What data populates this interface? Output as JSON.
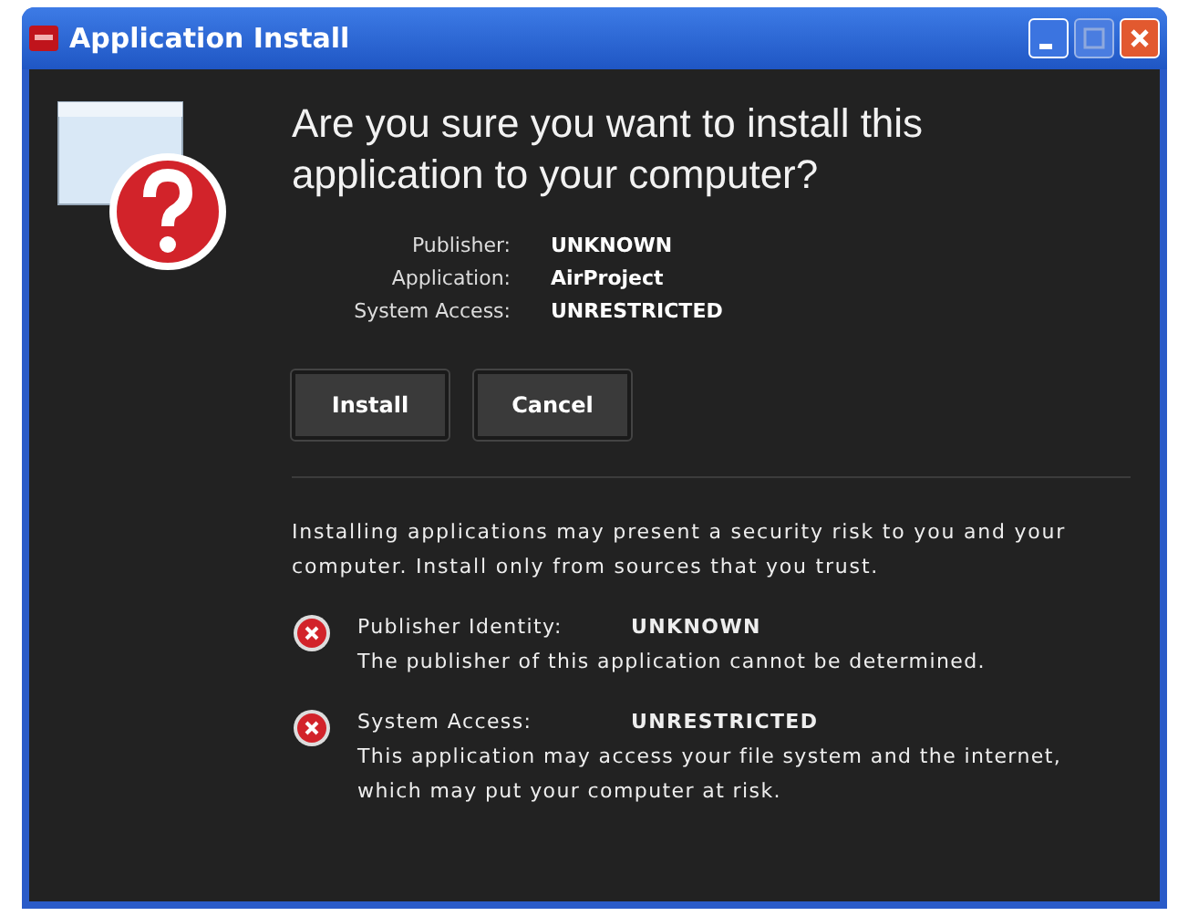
{
  "window": {
    "title": "Application Install"
  },
  "heading": "Are you sure you want to install this application to your computer?",
  "details": [
    {
      "label": "Publisher:",
      "value": "UNKNOWN"
    },
    {
      "label": "Application:",
      "value": "AirProject"
    },
    {
      "label": "System Access:",
      "value": "UNRESTRICTED"
    }
  ],
  "buttons": [
    "Install",
    "Cancel"
  ],
  "warning": "Installing applications may present a security risk to you and your computer. Install only from sources that you trust.",
  "risks": [
    {
      "label": "Publisher Identity:",
      "value": "UNKNOWN",
      "description": "The publisher of this application cannot be determined."
    },
    {
      "label": "System Access:",
      "value": "UNRESTRICTED",
      "description": "This application may access your file system and the internet, which may put your computer at risk."
    }
  ]
}
